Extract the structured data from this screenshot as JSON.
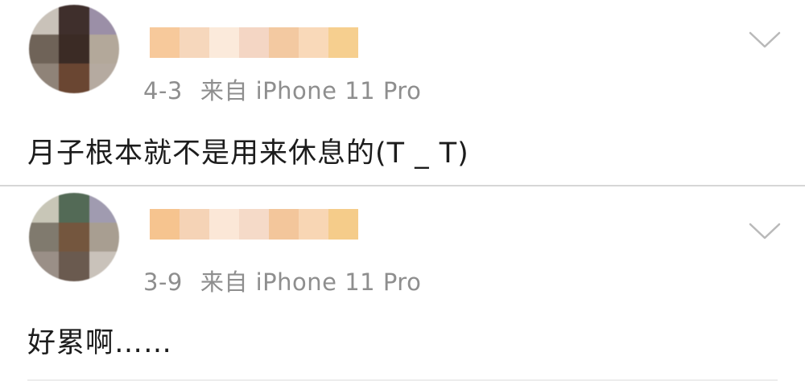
{
  "posts": [
    {
      "date": "4-3",
      "source": "来自 iPhone 11 Pro",
      "content": "月子根本就不是用来休息的(T _ T)",
      "avatar_colors": [
        "#c9c2b9",
        "#3f2f2c",
        "#9b8fa7",
        "#6f6358",
        "#3b2b25",
        "#b3a89a",
        "#8f8378",
        "#6a4632",
        "#b5aaa0"
      ],
      "name_colors": [
        "#f7c99b",
        "#f6d7bc",
        "#fbeadb",
        "#f4d6c4",
        "#f3c9a1",
        "#f9d9b9",
        "#f6cf8f"
      ]
    },
    {
      "date": "3-9",
      "source": "来自 iPhone 11 Pro",
      "content": "好累啊……",
      "avatar_colors": [
        "#c8c6b7",
        "#536a56",
        "#a09bb0",
        "#807a6e",
        "#74563e",
        "#a89e91",
        "#9a8f87",
        "#6a5a4f",
        "#c9c2ba"
      ],
      "name_colors": [
        "#f6c48f",
        "#f5d3b6",
        "#fbe7d7",
        "#f5dac8",
        "#f3c69b",
        "#f8d6b4",
        "#f5cc8a"
      ]
    }
  ],
  "icons": {
    "chevron": "chevron-down-icon"
  }
}
